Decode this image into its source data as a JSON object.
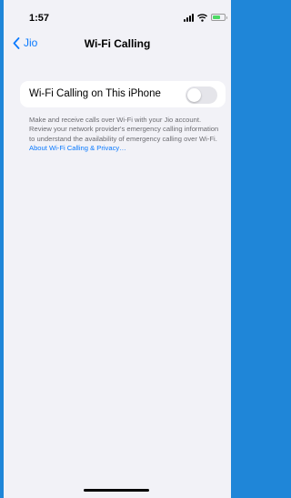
{
  "status_bar": {
    "time": "1:57",
    "battery_level": 0.7
  },
  "nav": {
    "back_label": "Jio",
    "title": "Wi-Fi Calling"
  },
  "setting": {
    "label": "Wi-Fi Calling on This iPhone",
    "enabled": false
  },
  "footer": {
    "text": "Make and receive calls over Wi-Fi with your Jio account. Review your network provider's emergency calling information to understand the availability of emergency calling over Wi-Fi. ",
    "link": "About Wi-Fi Calling & Privacy…"
  },
  "colors": {
    "accent": "#0a7aff",
    "background": "#f2f2f7",
    "toggle_off": "#e5e5ea"
  }
}
